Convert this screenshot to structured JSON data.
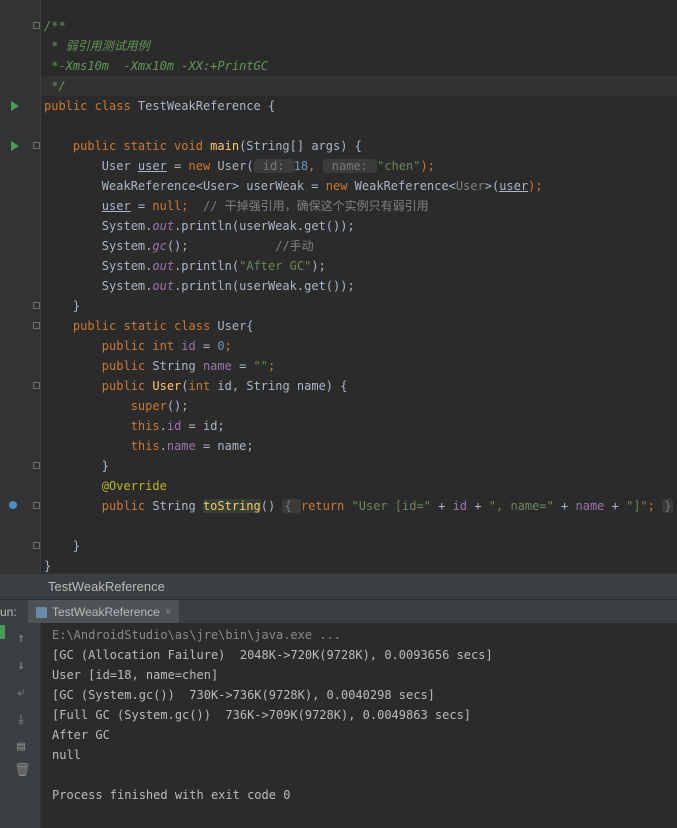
{
  "editor": {
    "lines": [
      {
        "parts": [
          {
            "t": "/**",
            "c": "doc"
          }
        ]
      },
      {
        "parts": [
          {
            "t": " * 弱引用测试用例",
            "c": "doc"
          }
        ]
      },
      {
        "parts": [
          {
            "t": " *-Xms10m  -Xmx10m -XX:+PrintGC",
            "c": "doc"
          }
        ]
      },
      {
        "parts": [
          {
            "t": " */",
            "c": "doc"
          }
        ]
      },
      {
        "parts": [
          {
            "t": "public class ",
            "c": "kw"
          },
          {
            "t": "TestWeakReference {",
            "c": ""
          }
        ]
      },
      {
        "parts": []
      },
      {
        "parts": [
          {
            "t": "    public static void ",
            "c": "kw"
          },
          {
            "t": "main",
            "c": "fn"
          },
          {
            "t": "(String[] args) {",
            "c": ""
          }
        ]
      },
      {
        "parts": [
          {
            "t": "        User ",
            "c": ""
          },
          {
            "t": "user",
            "c": "uline"
          },
          {
            "t": " = ",
            "c": ""
          },
          {
            "t": "new ",
            "c": "kw"
          },
          {
            "t": "User(",
            "c": ""
          },
          {
            "t": " id: ",
            "c": "hint"
          },
          {
            "t": "18",
            "c": "num"
          },
          {
            "t": ", ",
            "c": "kw"
          },
          {
            "t": " name: ",
            "c": "hint"
          },
          {
            "t": "\"chen\"",
            "c": "str"
          },
          {
            "t": ");",
            "c": "kw"
          }
        ]
      },
      {
        "parts": [
          {
            "t": "        WeakReference<User> userWeak = ",
            "c": ""
          },
          {
            "t": "new ",
            "c": "kw"
          },
          {
            "t": "WeakReference<",
            "c": ""
          },
          {
            "t": "User",
            "c": "cmt"
          },
          {
            "t": ">(",
            "c": ""
          },
          {
            "t": "user",
            "c": "uline"
          },
          {
            "t": ");",
            "c": "kw"
          }
        ]
      },
      {
        "parts": [
          {
            "t": "        ",
            "c": ""
          },
          {
            "t": "user",
            "c": "uline"
          },
          {
            "t": " = ",
            "c": ""
          },
          {
            "t": "null",
            "c": "kw"
          },
          {
            "t": ";  ",
            "c": "kw"
          },
          {
            "t": "// 干掉强引用，确保这个实例只有弱引用",
            "c": "cmt"
          }
        ]
      },
      {
        "parts": [
          {
            "t": "        System.",
            "c": ""
          },
          {
            "t": "out",
            "c": "static"
          },
          {
            "t": ".println(userWeak.get());",
            "c": ""
          }
        ]
      },
      {
        "parts": [
          {
            "t": "        System.",
            "c": ""
          },
          {
            "t": "gc",
            "c": "static"
          },
          {
            "t": "();            ",
            "c": ""
          },
          {
            "t": "//手动",
            "c": "cmt"
          }
        ]
      },
      {
        "parts": [
          {
            "t": "        System.",
            "c": ""
          },
          {
            "t": "out",
            "c": "static"
          },
          {
            "t": ".println(",
            "c": ""
          },
          {
            "t": "\"After GC\"",
            "c": "str"
          },
          {
            "t": ");",
            "c": ""
          }
        ]
      },
      {
        "parts": [
          {
            "t": "        System.",
            "c": ""
          },
          {
            "t": "out",
            "c": "static"
          },
          {
            "t": ".println(userWeak.get());",
            "c": ""
          }
        ]
      },
      {
        "parts": [
          {
            "t": "    }",
            "c": ""
          }
        ]
      },
      {
        "parts": [
          {
            "t": "    public static class ",
            "c": "kw"
          },
          {
            "t": "User{",
            "c": ""
          }
        ]
      },
      {
        "parts": [
          {
            "t": "        public int ",
            "c": "kw"
          },
          {
            "t": "id",
            "c": "field"
          },
          {
            "t": " = ",
            "c": ""
          },
          {
            "t": "0",
            "c": "num"
          },
          {
            "t": ";",
            "c": "kw"
          }
        ]
      },
      {
        "parts": [
          {
            "t": "        public ",
            "c": "kw"
          },
          {
            "t": "String ",
            "c": ""
          },
          {
            "t": "name",
            "c": "field"
          },
          {
            "t": " = ",
            "c": ""
          },
          {
            "t": "\"\"",
            "c": "str"
          },
          {
            "t": ";",
            "c": "kw"
          }
        ]
      },
      {
        "parts": [
          {
            "t": "        public ",
            "c": "kw"
          },
          {
            "t": "User",
            "c": "fn"
          },
          {
            "t": "(",
            "c": ""
          },
          {
            "t": "int ",
            "c": "kw"
          },
          {
            "t": "id, String name) {",
            "c": ""
          }
        ]
      },
      {
        "parts": [
          {
            "t": "            ",
            "c": ""
          },
          {
            "t": "super",
            "c": "kw"
          },
          {
            "t": "();",
            "c": ""
          }
        ]
      },
      {
        "parts": [
          {
            "t": "            ",
            "c": ""
          },
          {
            "t": "this",
            "c": "kw"
          },
          {
            "t": ".",
            "c": ""
          },
          {
            "t": "id",
            "c": "field"
          },
          {
            "t": " = id;",
            "c": ""
          }
        ]
      },
      {
        "parts": [
          {
            "t": "            ",
            "c": ""
          },
          {
            "t": "this",
            "c": "kw"
          },
          {
            "t": ".",
            "c": ""
          },
          {
            "t": "name",
            "c": "field"
          },
          {
            "t": " = name;",
            "c": ""
          }
        ]
      },
      {
        "parts": [
          {
            "t": "        }",
            "c": ""
          }
        ]
      },
      {
        "parts": [
          {
            "t": "        @Override",
            "c": "ann"
          }
        ]
      },
      {
        "parts": [
          {
            "t": "        public ",
            "c": "kw"
          },
          {
            "t": "String ",
            "c": ""
          },
          {
            "t": "toString",
            "c": "fn hl-word"
          },
          {
            "t": "() ",
            "c": ""
          },
          {
            "t": "{ ",
            "c": "hint"
          },
          {
            "t": "return ",
            "c": "kw"
          },
          {
            "t": "\"User [id=\"",
            "c": "str"
          },
          {
            "t": " + ",
            "c": ""
          },
          {
            "t": "id",
            "c": "field"
          },
          {
            "t": " + ",
            "c": ""
          },
          {
            "t": "\", name=\"",
            "c": "str"
          },
          {
            "t": " + ",
            "c": ""
          },
          {
            "t": "name",
            "c": "field"
          },
          {
            "t": " + ",
            "c": ""
          },
          {
            "t": "\"]\"",
            "c": "str"
          },
          {
            "t": "; ",
            "c": "kw"
          },
          {
            "t": "}",
            "c": "hint"
          }
        ]
      },
      {
        "parts": []
      },
      {
        "parts": [
          {
            "t": "    }",
            "c": ""
          }
        ]
      },
      {
        "parts": [
          {
            "t": "}",
            "c": ""
          }
        ]
      }
    ]
  },
  "breadcrumb": {
    "label": "TestWeakReference"
  },
  "run_panel": {
    "label": "un:",
    "tab_label": "TestWeakReference",
    "close_glyph": "×"
  },
  "console": {
    "lines": [
      "E:\\AndroidStudio\\as\\jre\\bin\\java.exe ...",
      "[GC (Allocation Failure)  2048K->720K(9728K), 0.0093656 secs]",
      "User [id=18, name=chen]",
      "[GC (System.gc())  730K->736K(9728K), 0.0040298 secs]",
      "[Full GC (System.gc())  736K->709K(9728K), 0.0049863 secs]",
      "After GC",
      "null",
      "",
      "Process finished with exit code 0"
    ]
  },
  "icons": {
    "up": "↑",
    "down": "↓",
    "wrap": "⤶",
    "scroll_end": "⤓",
    "print": "▤",
    "trash": "🗑"
  }
}
